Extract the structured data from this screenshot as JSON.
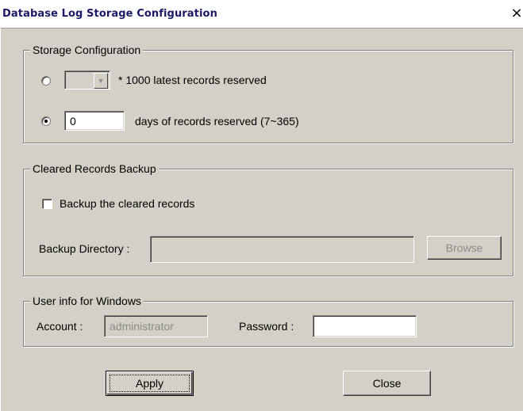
{
  "window": {
    "title": "Database Log Storage Configuration",
    "close_glyph": "×"
  },
  "storage": {
    "legend": "Storage Configuration",
    "option_records": {
      "selected": false,
      "value": "",
      "label": "* 1000 latest records reserved"
    },
    "option_days": {
      "selected": true,
      "value": "0",
      "label": "days of records reserved (7~365)"
    }
  },
  "backup": {
    "legend": "Cleared Records Backup",
    "checkbox_label": "Backup the cleared records",
    "checked": false,
    "directory_label": "Backup Directory :",
    "directory_value": "",
    "browse_label": "Browse"
  },
  "user": {
    "legend": "User info for Windows",
    "account_label": "Account :",
    "account_value": "administrator",
    "password_label": "Password :",
    "password_value": ""
  },
  "buttons": {
    "apply": "Apply",
    "close": "Close"
  },
  "icons": {
    "combo_arrow": "chevron-down-icon",
    "close": "close-icon"
  }
}
